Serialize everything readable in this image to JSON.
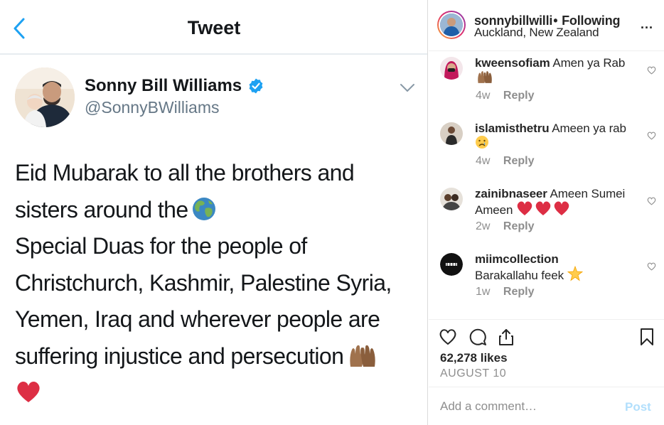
{
  "tweet": {
    "header_title": "Tweet",
    "back_icon": "chevron-left-icon",
    "author_name": "Sonny Bill Williams",
    "author_handle": "@SonnyBWilliams",
    "verified_icon": "verified-badge-icon",
    "body_lines": [
      "Eid Mubarak to all the brothers and",
      "sisters around the",
      "Special Duas for the people of",
      "Christchurch, Kashmir, Palestine Syria,",
      "Yemen, Iraq and wherever people are",
      "suffering injustice and persecution"
    ],
    "emojis": [
      "globe-emoji",
      "raised-hands-emoji",
      "red-heart-emoji"
    ],
    "colors": {
      "accent": "#1da1f2",
      "text": "#14171a",
      "secondary": "#657786"
    }
  },
  "instagram": {
    "header": {
      "username": "sonnybillwilli",
      "separator": "•",
      "following_label": "Following",
      "location": "Auckland, New Zealand",
      "more_label": "..."
    },
    "comments": [
      {
        "user": "kweensofiam",
        "text": "Amen ya Rab",
        "emoji": "raised-hands-emoji",
        "time": "4w",
        "reply_label": "Reply"
      },
      {
        "user": "islamisthetru",
        "text": "Ameen ya rab",
        "emoji": "crying-face-emoji",
        "time": "4w",
        "reply_label": "Reply"
      },
      {
        "user": "zainibnaseer",
        "text": "Ameen Sumei Ameen",
        "emoji": "three-red-hearts-emoji",
        "time": "2w",
        "reply_label": "Reply"
      },
      {
        "user": "miimcollection",
        "text": "Barakallahu feek",
        "emoji": "glowing-star-emoji",
        "time": "1w",
        "reply_label": "Reply"
      }
    ],
    "likes_label": "62,278 likes",
    "date_label": "AUGUST 10",
    "comment_placeholder": "Add a comment…",
    "post_label": "Post",
    "colors": {
      "post_disabled": "#b2dffc",
      "meta": "#8e8e8e"
    }
  }
}
